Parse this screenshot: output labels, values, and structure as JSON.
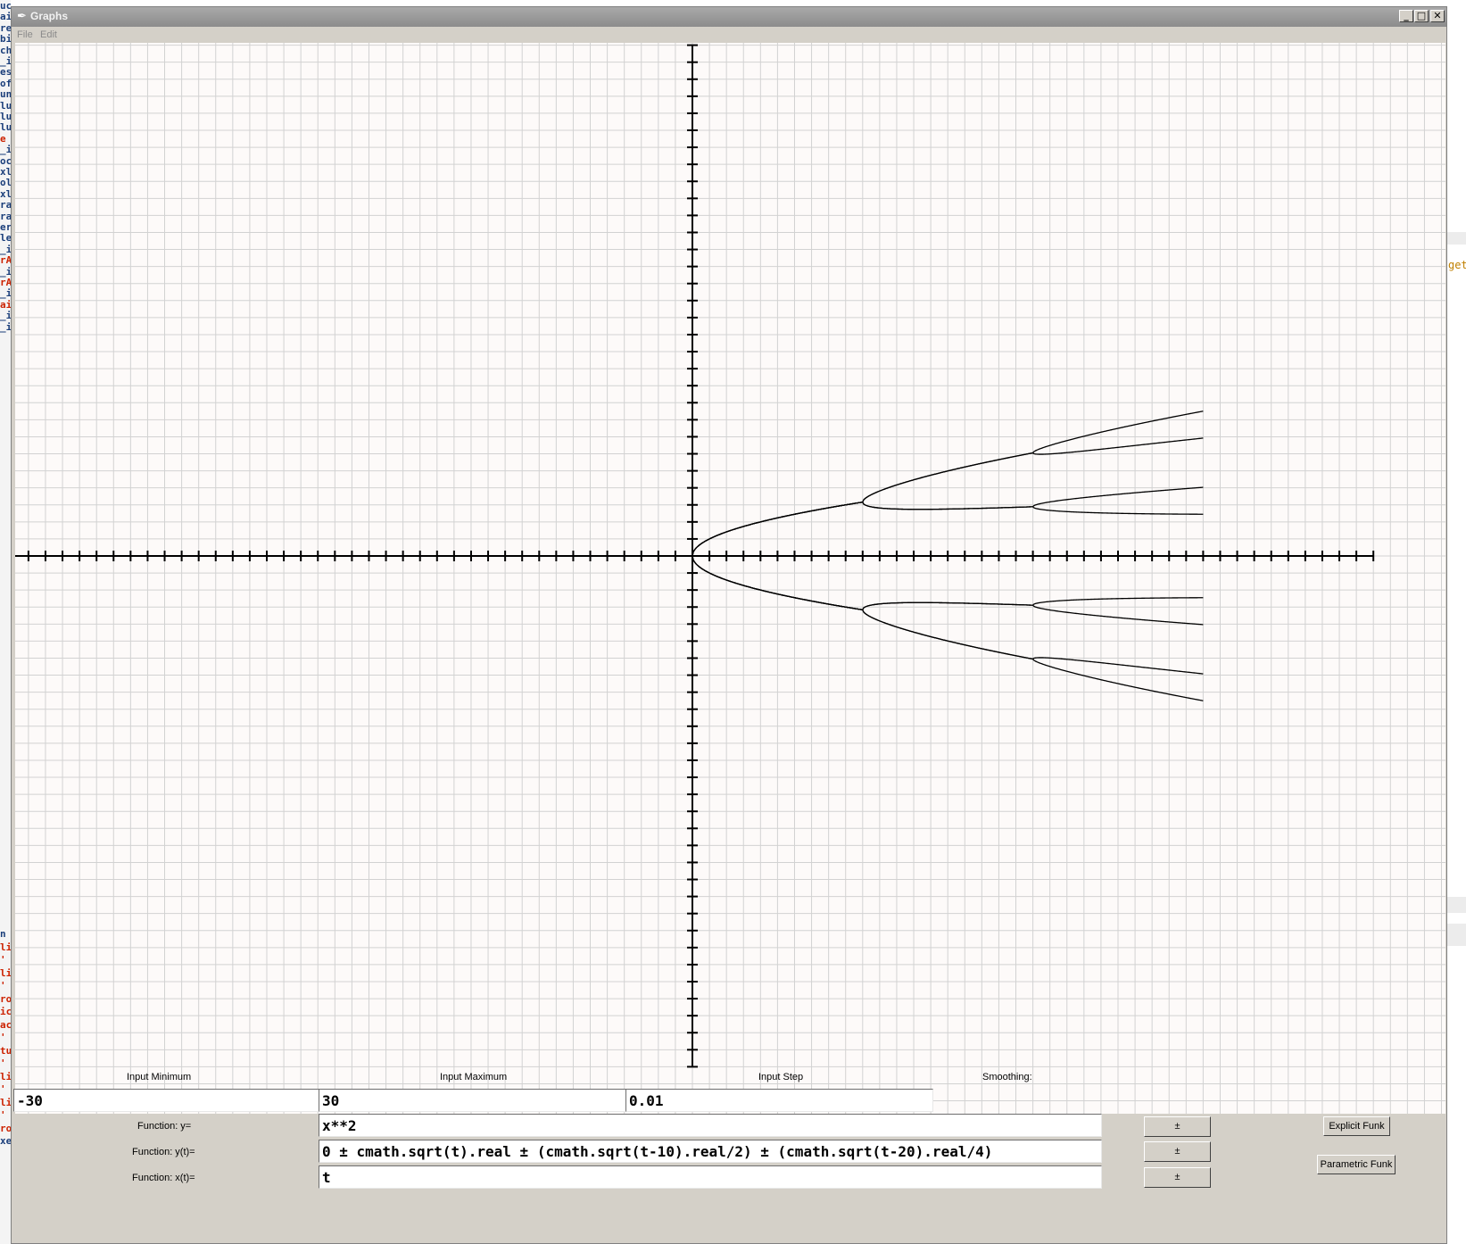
{
  "background": {
    "left_fragments": [
      {
        "text": "uc",
        "red": false
      },
      {
        "text": "ai",
        "red": false
      },
      {
        "text": "re",
        "red": false
      },
      {
        "text": "bi",
        "red": false
      },
      {
        "text": "ch",
        "red": false
      },
      {
        "text": "_i",
        "red": false
      },
      {
        "text": "es",
        "red": false
      },
      {
        "text": "of",
        "red": false
      },
      {
        "text": "un",
        "red": false
      },
      {
        "text": "lu",
        "red": false
      },
      {
        "text": "lu",
        "red": false
      },
      {
        "text": "lu",
        "red": false
      },
      {
        "text": "e",
        "red": true
      },
      {
        "text": "_i",
        "red": false
      },
      {
        "text": "oc",
        "red": false
      },
      {
        "text": "xl",
        "red": false
      },
      {
        "text": "ol",
        "red": false
      },
      {
        "text": "xl",
        "red": false
      },
      {
        "text": "ra",
        "red": false
      },
      {
        "text": "ra",
        "red": false
      },
      {
        "text": "er",
        "red": false
      },
      {
        "text": "le",
        "red": false
      },
      {
        "text": "_i",
        "red": false
      },
      {
        "text": "rA",
        "red": true
      },
      {
        "text": "_i",
        "red": false
      },
      {
        "text": "rA",
        "red": true
      },
      {
        "text": "_i",
        "red": false
      },
      {
        "text": "ai",
        "red": true
      },
      {
        "text": "_i",
        "red": false
      },
      {
        "text": "_i",
        "red": false
      },
      {
        "text": "n :",
        "red": false
      },
      {
        "text": "li",
        "red": true
      },
      {
        "text": "'",
        "red": true
      },
      {
        "text": "li",
        "red": true
      },
      {
        "text": "'",
        "red": true
      },
      {
        "text": "ro",
        "red": true
      },
      {
        "text": "ic",
        "red": true
      },
      {
        "text": "ac",
        "red": true
      },
      {
        "text": "'",
        "red": true
      },
      {
        "text": "tu",
        "red": true
      },
      {
        "text": "'",
        "red": true
      },
      {
        "text": "li",
        "red": true
      },
      {
        "text": "'",
        "red": true
      },
      {
        "text": "li",
        "red": true
      },
      {
        "text": "'",
        "red": true
      },
      {
        "text": "ro",
        "red": true
      },
      {
        "text": "xe",
        "red": false
      }
    ],
    "right_fragment": "get"
  },
  "window": {
    "title": "Graphs",
    "title_icon": "feather-icon",
    "controls": {
      "minimize": "_",
      "maximize": "□",
      "close": "✕"
    }
  },
  "menu": {
    "file": "File",
    "edit": "Edit"
  },
  "graph": {
    "colors": {
      "background": "#fdfaf9",
      "grid": "#d2d2d2",
      "axis": "#000000",
      "curve": "#000000"
    },
    "grid": true,
    "x_axis_ticks": 40,
    "y_axis_ticks": 30
  },
  "chart_data": {
    "type": "line",
    "title": "",
    "xlabel": "",
    "ylabel": "",
    "xlim": [
      -40,
      40
    ],
    "ylim": [
      -30,
      30
    ],
    "x_tick_step": 1,
    "y_tick_step": 1,
    "grid": true,
    "series": [
      {
        "formula": "0 + sqrt(t) + sqrt(t-10)/2 + sqrt(t-20)/4",
        "t_range": [
          0,
          30
        ]
      },
      {
        "formula": "0 + sqrt(t) + sqrt(t-10)/2 - sqrt(t-20)/4",
        "t_range": [
          0,
          30
        ]
      },
      {
        "formula": "0 + sqrt(t) - sqrt(t-10)/2 + sqrt(t-20)/4",
        "t_range": [
          0,
          30
        ]
      },
      {
        "formula": "0 + sqrt(t) - sqrt(t-10)/2 - sqrt(t-20)/4",
        "t_range": [
          0,
          30
        ]
      },
      {
        "formula": "0 - sqrt(t) + sqrt(t-10)/2 + sqrt(t-20)/4",
        "t_range": [
          0,
          30
        ]
      },
      {
        "formula": "0 - sqrt(t) + sqrt(t-10)/2 - sqrt(t-20)/4",
        "t_range": [
          0,
          30
        ]
      },
      {
        "formula": "0 - sqrt(t) - sqrt(t-10)/2 + sqrt(t-20)/4",
        "t_range": [
          0,
          30
        ]
      },
      {
        "formula": "0 - sqrt(t) - sqrt(t-10)/2 - sqrt(t-20)/4",
        "t_range": [
          0,
          30
        ]
      }
    ]
  },
  "controls": {
    "input_min_label": "Input Minimum",
    "input_max_label": "Input Maximum",
    "input_step_label": "Input Step",
    "smoothing_label": "Smoothing:",
    "smoothing_checked": false,
    "input_min": "-30",
    "input_max": "30",
    "input_step": "0.01",
    "func_y_label": "Function: y=",
    "func_yt_label": "Function: y(t)=",
    "func_xt_label": "Function: x(t)=",
    "func_y": "x**2",
    "func_yt": "0 ± cmath.sqrt(t).real ± (cmath.sqrt(t-10).real/2) ± (cmath.sqrt(t-20).real/4)",
    "func_xt": "t",
    "pm_button": "±",
    "explicit_button": "Explicit Funk",
    "parametric_button": "Parametric Funk"
  }
}
